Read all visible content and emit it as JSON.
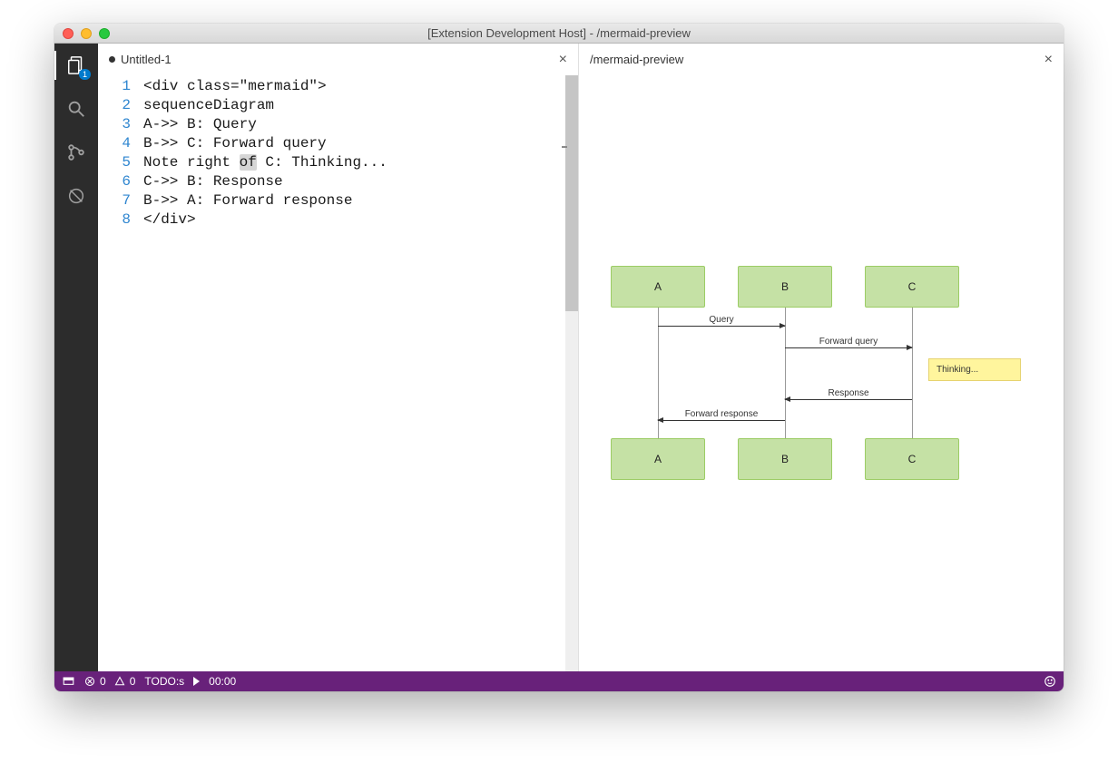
{
  "window": {
    "title": "[Extension Development Host] - /mermaid-preview"
  },
  "activitybar": {
    "explorer_badge": "1"
  },
  "editorTab": {
    "name": "Untitled-1"
  },
  "previewTab": {
    "name": "/mermaid-preview"
  },
  "lineNumbers": [
    "1",
    "2",
    "3",
    "4",
    "5",
    "6",
    "7",
    "8"
  ],
  "code": {
    "l1": "<div class=\"mermaid\">",
    "l2": "sequenceDiagram",
    "l3": "A->> B: Query",
    "l4": "B->> C: Forward query",
    "l5a": "Note right ",
    "l5sel": "of",
    "l5b": " C: Thinking...",
    "l6": "C->> B: Response",
    "l7": "B->> A: Forward response",
    "l8": "</div>"
  },
  "diagram": {
    "actors": {
      "A": "A",
      "B": "B",
      "C": "C"
    },
    "messages": {
      "q": "Query",
      "fq": "Forward query",
      "r": "Response",
      "fr": "Forward response"
    },
    "note": "Thinking..."
  },
  "chart_data": {
    "type": "sequence",
    "participants": [
      "A",
      "B",
      "C"
    ],
    "steps": [
      {
        "from": "A",
        "to": "B",
        "label": "Query"
      },
      {
        "from": "B",
        "to": "C",
        "label": "Forward query"
      },
      {
        "note": {
          "position": "right",
          "of": "C",
          "text": "Thinking..."
        }
      },
      {
        "from": "C",
        "to": "B",
        "label": "Response"
      },
      {
        "from": "B",
        "to": "A",
        "label": "Forward response"
      }
    ]
  },
  "statusbar": {
    "errors": "0",
    "warnings": "0",
    "todo": "TODO:s",
    "time": "00:00"
  }
}
